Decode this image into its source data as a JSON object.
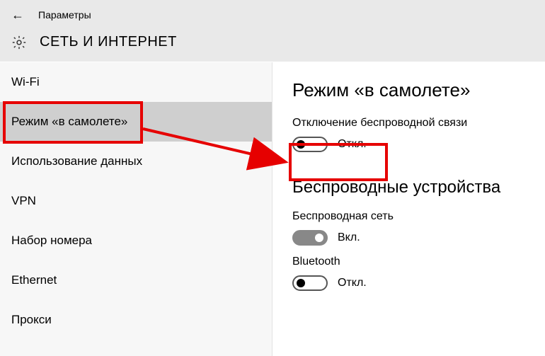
{
  "header": {
    "back_icon": "←",
    "title_small": "Параметры",
    "section_title": "СЕТЬ И ИНТЕРНЕТ"
  },
  "sidebar": {
    "items": [
      {
        "label": "Wi-Fi",
        "selected": false
      },
      {
        "label": "Режим «в самолете»",
        "selected": true
      },
      {
        "label": "Использование данных",
        "selected": false
      },
      {
        "label": "VPN",
        "selected": false
      },
      {
        "label": "Набор номера",
        "selected": false
      },
      {
        "label": "Ethernet",
        "selected": false
      },
      {
        "label": "Прокси",
        "selected": false
      }
    ]
  },
  "main": {
    "heading1": "Режим «в самолете»",
    "airplane": {
      "label": "Отключение беспроводной связи",
      "state_text": "Откл.",
      "on": false
    },
    "heading2": "Беспроводные устройства",
    "wireless_net": {
      "label": "Беспроводная сеть",
      "state_text": "Вкл.",
      "on": true
    },
    "bluetooth": {
      "label": "Bluetooth",
      "state_text": "Откл.",
      "on": false
    }
  },
  "annotation": {
    "color": "#e60000"
  }
}
